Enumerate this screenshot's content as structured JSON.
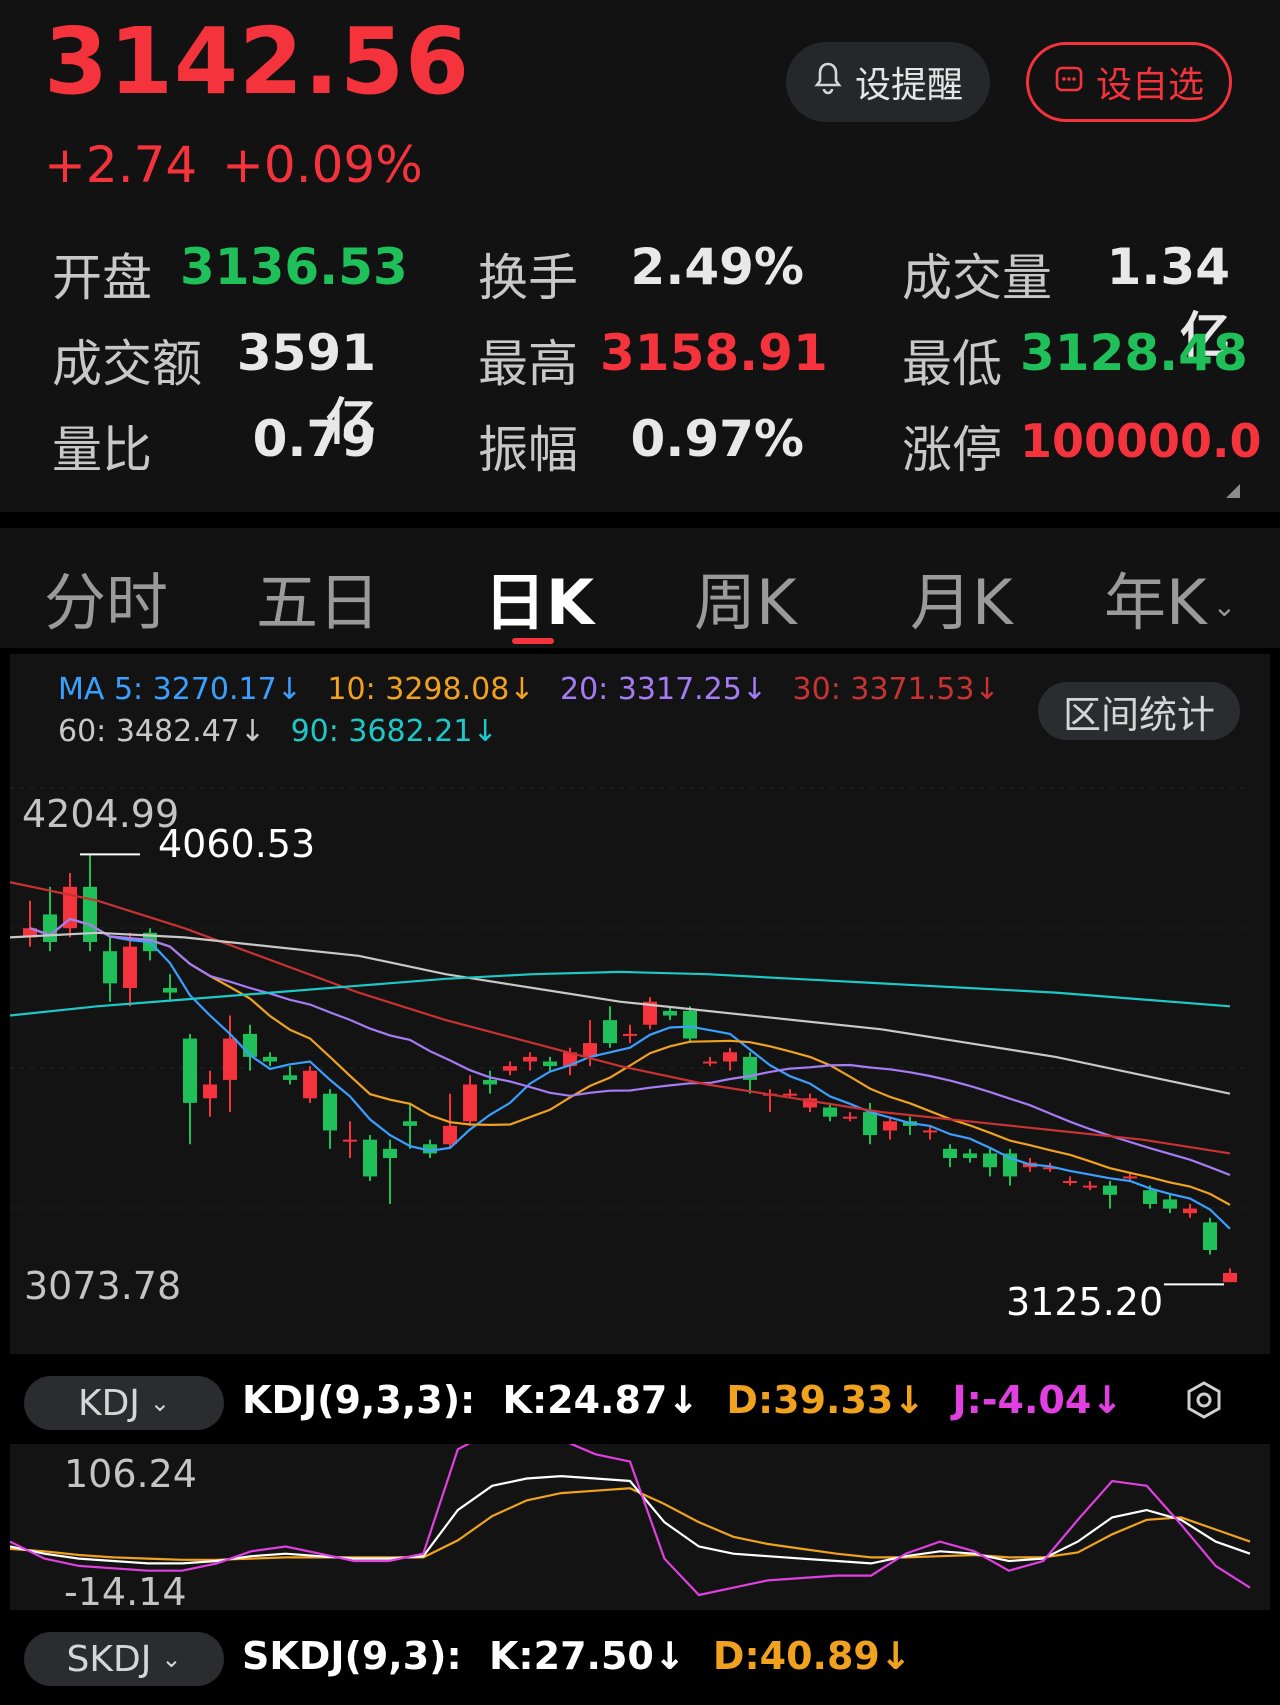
{
  "quote": {
    "price": "3142.56",
    "change": "+2.74",
    "change_pct": "+0.09%",
    "alert_label": "设提醒",
    "fav_label": "设自选",
    "stats": [
      {
        "label": "开盘",
        "value": "3136.53",
        "color": "#1fbf5a"
      },
      {
        "label": "换手",
        "value": "2.49%",
        "color": "#e8e8e8"
      },
      {
        "label": "成交量",
        "value": "1.34亿",
        "color": "#e8e8e8"
      },
      {
        "label": "成交额",
        "value": "3591亿",
        "color": "#e8e8e8"
      },
      {
        "label": "最高",
        "value": "3158.91",
        "color": "#f5333d"
      },
      {
        "label": "最低",
        "value": "3128.48",
        "color": "#1fbf5a"
      },
      {
        "label": "量比",
        "value": "0.79",
        "color": "#e8e8e8"
      },
      {
        "label": "振幅",
        "value": "0.97%",
        "color": "#e8e8e8"
      },
      {
        "label": "涨停",
        "value": "100000.0",
        "color": "#f5333d"
      }
    ]
  },
  "tabs": {
    "items": [
      "分时",
      "五日",
      "日K",
      "周K",
      "月K",
      "年K"
    ],
    "active_index": 2
  },
  "ma": {
    "row1": [
      {
        "text": "MA 5: 3270.17↓",
        "color": "#3aa0ff"
      },
      {
        "text": "10: 3298.08↓",
        "color": "#f0a21e"
      },
      {
        "text": "20: 3317.25↓",
        "color": "#a57cf5"
      },
      {
        "text": "30: 3371.53↓",
        "color": "#c83232"
      }
    ],
    "row2": [
      {
        "text": "60: 3482.47↓",
        "color": "#c8c8c8"
      },
      {
        "text": "90: 3682.21↓",
        "color": "#1ec8c8"
      }
    ],
    "range_button": "区间统计"
  },
  "chart_data": {
    "type": "candlestick",
    "y_top_label": "4204.99",
    "y_bottom_label": "3073.78",
    "ylim": [
      3073.78,
      4204.99
    ],
    "max_annotation": "4060.53",
    "min_annotation": "3125.20",
    "candles": [
      [
        3880,
        3900,
        3960,
        3860
      ],
      [
        3930,
        3870,
        3990,
        3850
      ],
      [
        3900,
        3990,
        4020,
        3880
      ],
      [
        3990,
        3870,
        4060,
        3850
      ],
      [
        3850,
        3780,
        3880,
        3740
      ],
      [
        3770,
        3860,
        3890,
        3730
      ],
      [
        3890,
        3850,
        3900,
        3830
      ],
      [
        3770,
        3760,
        3800,
        3740
      ],
      [
        3660,
        3520,
        3670,
        3430
      ],
      [
        3530,
        3560,
        3590,
        3490
      ],
      [
        3570,
        3660,
        3710,
        3500
      ],
      [
        3670,
        3620,
        3690,
        3590
      ],
      [
        3620,
        3610,
        3630,
        3600
      ],
      [
        3580,
        3570,
        3600,
        3560
      ],
      [
        3530,
        3590,
        3600,
        3520
      ],
      [
        3540,
        3460,
        3550,
        3420
      ],
      [
        3440,
        3440,
        3480,
        3400
      ],
      [
        3440,
        3360,
        3450,
        3350
      ],
      [
        3420,
        3400,
        3440,
        3300
      ],
      [
        3480,
        3470,
        3520,
        3420
      ],
      [
        3430,
        3410,
        3440,
        3400
      ],
      [
        3430,
        3470,
        3540,
        3420
      ],
      [
        3480,
        3560,
        3580,
        3470
      ],
      [
        3570,
        3560,
        3590,
        3540
      ],
      [
        3590,
        3600,
        3610,
        3580
      ],
      [
        3610,
        3620,
        3630,
        3590
      ],
      [
        3610,
        3600,
        3620,
        3590
      ],
      [
        3600,
        3630,
        3640,
        3580
      ],
      [
        3620,
        3650,
        3700,
        3600
      ],
      [
        3700,
        3650,
        3730,
        3640
      ],
      [
        3670,
        3670,
        3690,
        3650
      ],
      [
        3690,
        3740,
        3750,
        3680
      ],
      [
        3720,
        3710,
        3730,
        3700
      ],
      [
        3720,
        3660,
        3730,
        3650
      ],
      [
        3610,
        3610,
        3620,
        3600
      ],
      [
        3610,
        3630,
        3640,
        3590
      ],
      [
        3620,
        3570,
        3630,
        3540
      ],
      [
        3540,
        3540,
        3550,
        3500
      ],
      [
        3540,
        3540,
        3550,
        3530
      ],
      [
        3510,
        3530,
        3540,
        3500
      ],
      [
        3510,
        3490,
        3520,
        3480
      ],
      [
        3490,
        3490,
        3500,
        3480
      ],
      [
        3500,
        3450,
        3520,
        3430
      ],
      [
        3460,
        3480,
        3490,
        3440
      ],
      [
        3480,
        3470,
        3490,
        3450
      ],
      [
        3460,
        3460,
        3470,
        3440
      ],
      [
        3420,
        3400,
        3430,
        3380
      ],
      [
        3410,
        3400,
        3420,
        3390
      ],
      [
        3410,
        3380,
        3420,
        3360
      ],
      [
        3410,
        3360,
        3420,
        3340
      ],
      [
        3380,
        3390,
        3400,
        3370
      ],
      [
        3380,
        3380,
        3390,
        3370
      ],
      [
        3350,
        3350,
        3360,
        3340
      ],
      [
        3340,
        3340,
        3350,
        3330
      ],
      [
        3340,
        3320,
        3350,
        3290
      ],
      [
        3360,
        3360,
        3370,
        3350
      ],
      [
        3330,
        3300,
        3340,
        3290
      ],
      [
        3310,
        3290,
        3320,
        3280
      ],
      [
        3280,
        3290,
        3300,
        3270
      ],
      [
        3260,
        3200,
        3270,
        3190
      ],
      [
        3130,
        3150,
        3160,
        3130
      ]
    ]
  },
  "kdj": {
    "selector": "KDJ",
    "title": "KDJ(9,3,3):",
    "k": "K:24.87↓",
    "d": "D:39.33↓",
    "j": "J:-4.04↓",
    "y_top_label": "106.24",
    "y_bottom_label": "-14.14",
    "colors": {
      "k": "#ffffff",
      "d": "#f0a21e",
      "j": "#e040e0"
    }
  },
  "skdj": {
    "selector": "SKDJ",
    "title": "SKDJ(9,3):",
    "k": "K:27.50↓",
    "d": "D:40.89↓"
  }
}
